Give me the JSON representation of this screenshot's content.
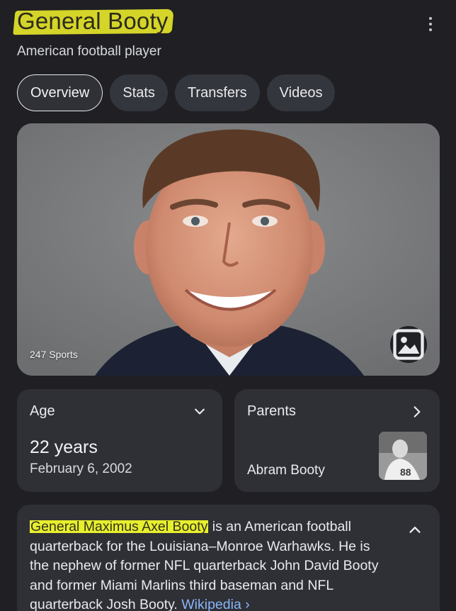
{
  "header": {
    "title": "General Booty",
    "subtitle": "American football player",
    "menu_icon": "more-vert-icon"
  },
  "tabs": [
    {
      "label": "Overview",
      "active": true
    },
    {
      "label": "Stats",
      "active": false
    },
    {
      "label": "Transfers",
      "active": false
    },
    {
      "label": "Videos",
      "active": false
    }
  ],
  "photo": {
    "credit": "247 Sports",
    "image_button_icon": "image-icon"
  },
  "age_card": {
    "label": "Age",
    "value": "22 years",
    "date": "February 6, 2002",
    "icon": "chevron-down-icon"
  },
  "parents_card": {
    "label": "Parents",
    "name": "Abram Booty",
    "icon": "chevron-right-icon"
  },
  "description": {
    "highlighted_name": "General Maximus Axel Booty",
    "text": " is an American football quarterback for the Louisiana–Monroe Warhawks. He is the nephew of former NFL quarterback John David Booty and former Miami Marlins third baseman and NFL quarterback Josh Booty.",
    "link": "Wikipedia ›",
    "icon": "chevron-up-icon"
  },
  "colors": {
    "background": "#1f1f24",
    "card": "#2e3036",
    "highlight": "#f6f52a",
    "link": "#8ab4f8"
  }
}
